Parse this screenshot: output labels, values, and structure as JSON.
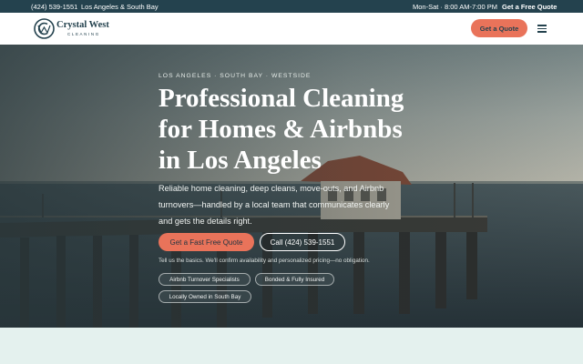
{
  "topbar": {
    "phone": "(424) 539-1551",
    "area": "Los Angeles & South Bay",
    "hours": "Mon-Sat · 8:00 AM-7:00 PM",
    "quote_link": "Get a Free Quote"
  },
  "header": {
    "logo_name": "Crystal West",
    "logo_sub": "CLEANING",
    "quote_button": "Get a Quote",
    "menu_icon": "hamburger-menu-icon"
  },
  "hero": {
    "eyebrow": "LOS ANGELES · SOUTH BAY · WESTSIDE",
    "title_lines": [
      "Professional Cleaning",
      "for Homes & Airbnbs",
      "in Los Angeles"
    ],
    "subtitle_lines": [
      "Reliable home cleaning, deep cleans, move-outs, and Airbnb",
      "turnovers—handled by a local team that communicates clearly",
      "and gets the details right."
    ],
    "primary_cta": "Get a Fast Free Quote",
    "call_cta": "Call (424) 539-1551",
    "helper": "Tell us the basics. We'll confirm availability and personalized pricing—no obligation.",
    "badges": [
      "Airbnb Turnover Specialists",
      "Bonded & Fully Insured",
      "Locally Owned in South Bay"
    ]
  },
  "colors": {
    "brand_navy": "#24424e",
    "accent_coral": "#e9735a",
    "mint_background": "#e4f1ee"
  }
}
